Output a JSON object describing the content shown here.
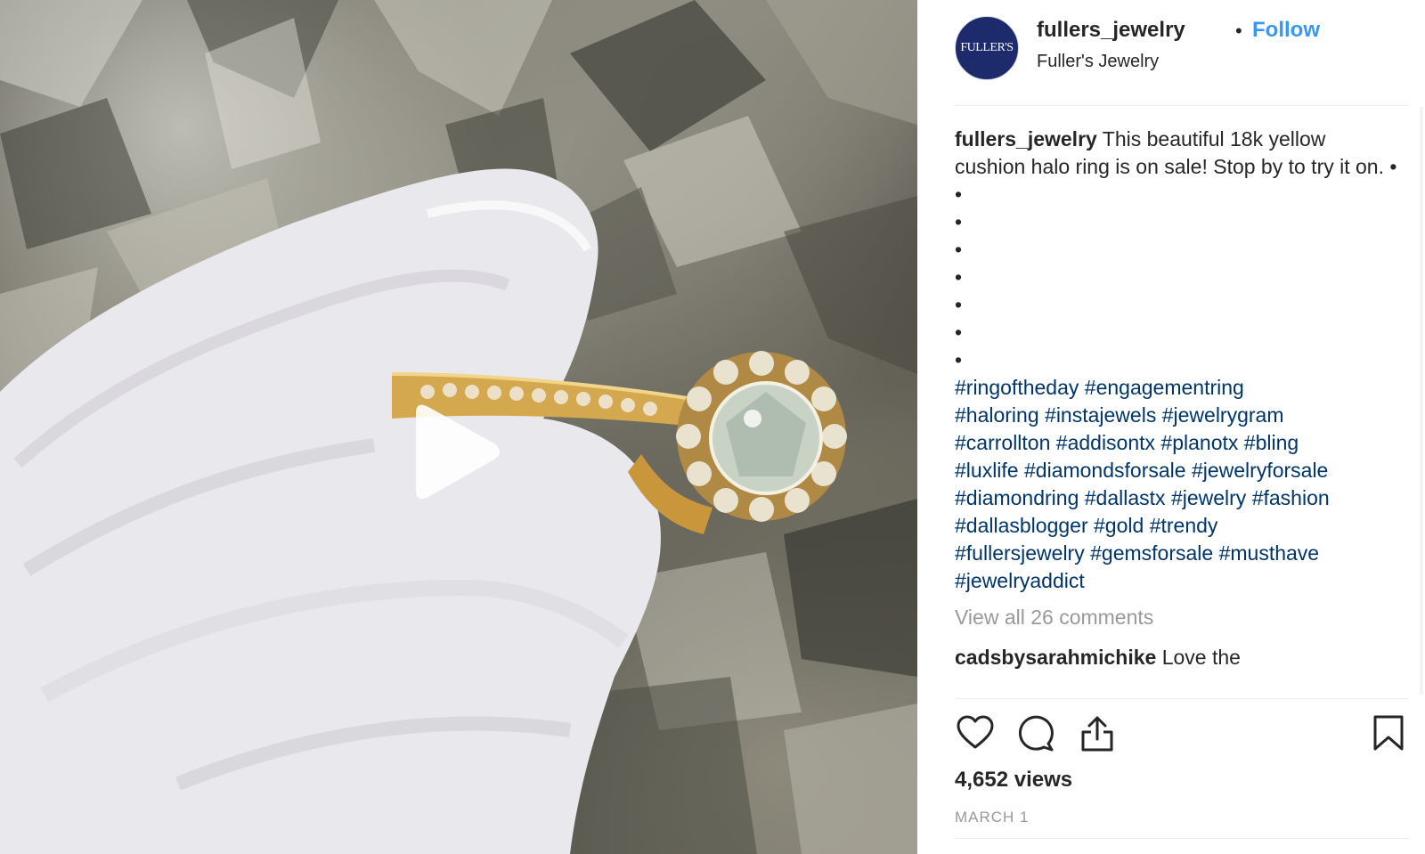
{
  "post": {
    "username": "fullers_jewelry",
    "separator": "•",
    "follow_label": "Follow",
    "full_name": "Fuller's Jewelry",
    "avatar_text": "FULLER'S"
  },
  "caption": {
    "username": "fullers_jewelry",
    "text": "This beautiful 18k yellow cushion halo ring is on sale! Stop by to try it on. •",
    "bullets": [
      "•",
      "•",
      "•",
      "•",
      "•",
      "•",
      "•"
    ],
    "hashtags": [
      "#ringoftheday",
      "#engagementring",
      "#haloring",
      "#instajewels",
      "#jewelrygram",
      "#carrollton",
      "#addisontx",
      "#planotx",
      "#bling",
      "#luxlife",
      "#diamondsforsale",
      "#jewelryforsale",
      "#diamondring",
      "#dallastx",
      "#jewelry",
      "#fashion",
      "#dallasblogger",
      "#gold",
      "#trendy",
      "#fullersjewelry",
      "#gemsforsale",
      "#musthave",
      "#jewelryaddict"
    ]
  },
  "comments": {
    "view_all_label": "View all 26 comments",
    "peek_user": "cadsbysarahmichike",
    "peek_text": "Love the"
  },
  "actions": {
    "like_icon": "heart-icon",
    "comment_icon": "speech-bubble-icon",
    "share_icon": "share-icon",
    "save_icon": "bookmark-icon"
  },
  "stats": {
    "views": "4,652 views",
    "date": "MARCH 1"
  },
  "colors": {
    "link_blue": "#3897f0",
    "hashtag_blue": "#003569",
    "muted_gray": "#999999",
    "text": "#262626"
  }
}
